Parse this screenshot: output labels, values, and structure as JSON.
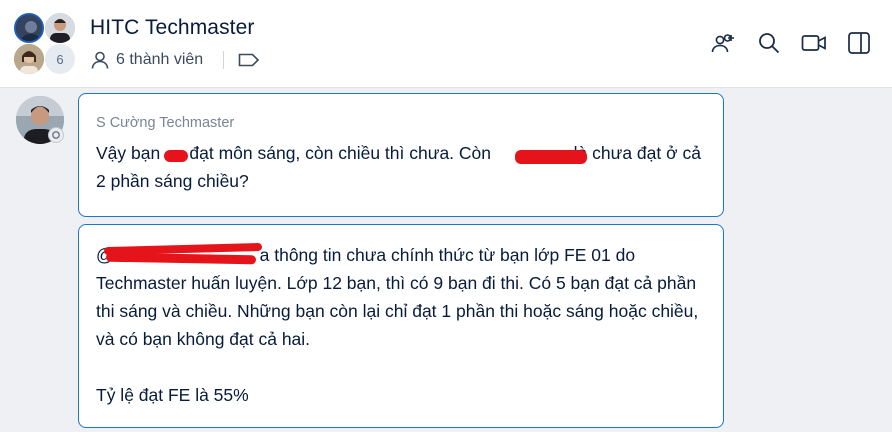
{
  "header": {
    "title": "HITC Techmaster",
    "member_count_label": "6 thành viên",
    "avatar_overflow_count": "6",
    "icons": [
      "add-member-icon",
      "search-icon",
      "video-call-icon",
      "side-panel-icon"
    ]
  },
  "messages": [
    {
      "sender": "S Cường Techmaster",
      "text": "Vậy bạn      đạt môn sáng, còn chiều thì chưa. Còn                 là chưa đạt ở cả 2 phần sáng chiều?"
    },
    {
      "text": "@                              a thông tin chưa chính thức từ bạn lớp FE 01 do Techmaster huấn luyện. Lớp 12 bạn, thì có 9 bạn đi thi. Có 5 bạn đạt cả phần thi sáng và chiều. Những bạn còn lại chỉ đạt 1 phần thi hoặc sáng hoặc chiều, và có bạn không đạt cả hai.\n\nTỷ lệ đạt FE là 55%"
    }
  ],
  "colors": {
    "accent": "#1a76d2",
    "redaction": "#e5141a",
    "background": "#eef0f3"
  }
}
